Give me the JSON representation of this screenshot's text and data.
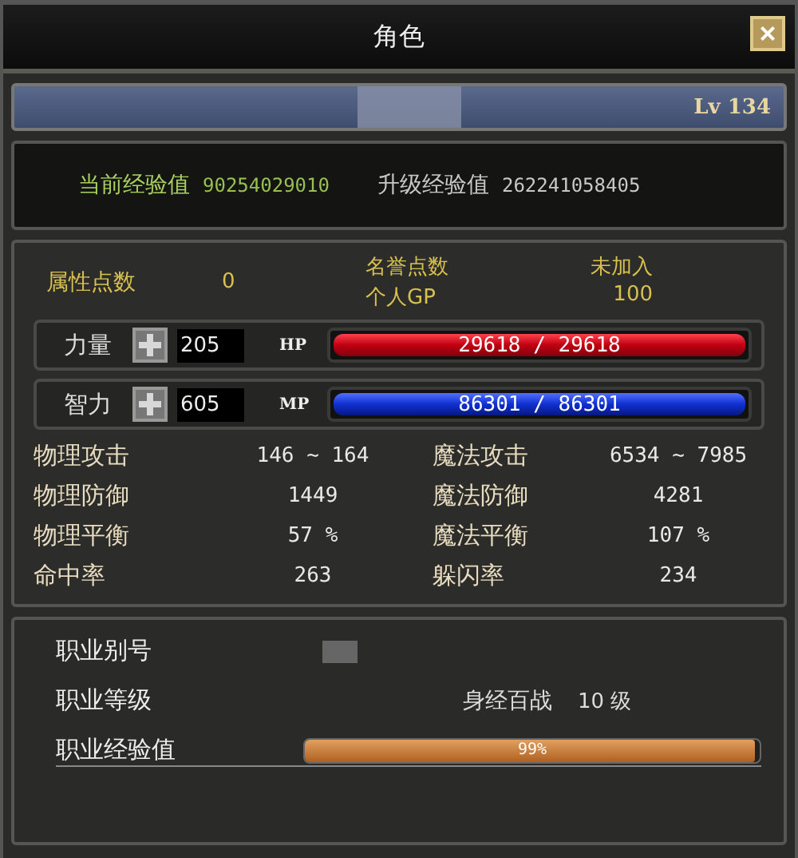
{
  "window": {
    "title": "角色",
    "close": "×"
  },
  "name_bar": {
    "level": "Lv 134"
  },
  "experience": {
    "current_label": "当前经验值",
    "current_value": "90254029010",
    "next_label": "升级经验值",
    "next_value": "262241058405"
  },
  "points": {
    "attribute_label": "属性点数",
    "attribute_value": "0",
    "honor_label": "名誉点数",
    "honor_value": "未加入",
    "gp_label": "个人GP",
    "gp_value": "100"
  },
  "attributes": [
    {
      "name": "力量",
      "value": "205",
      "bar_label": "HP",
      "kind": "hp",
      "level": 1,
      "reading": "29618 / 29618"
    },
    {
      "name": "智力",
      "value": "605",
      "bar_label": "MP",
      "kind": "mp",
      "level": 1,
      "reading": "86301 / 86301"
    }
  ],
  "stats": [
    {
      "label": "物理攻击",
      "value": "146 ~ 164"
    },
    {
      "label": "魔法攻击",
      "value": "6534 ~ 7985"
    },
    {
      "label": "物理防御",
      "value": "1449"
    },
    {
      "label": "魔法防御",
      "value": "4281"
    },
    {
      "label": "物理平衡",
      "value": "57 %"
    },
    {
      "label": "魔法平衡",
      "value": "107 %"
    },
    {
      "label": "命中率",
      "value": "263"
    },
    {
      "label": "躲闪率",
      "value": "234"
    }
  ],
  "job": {
    "alias_label": "职业别号",
    "grade_label": "职业等级",
    "grade_name": "身经百战",
    "grade_value": "10 级",
    "exp": {
      "label": "职业经验值",
      "level": 0.99,
      "reading": "99%"
    }
  }
}
